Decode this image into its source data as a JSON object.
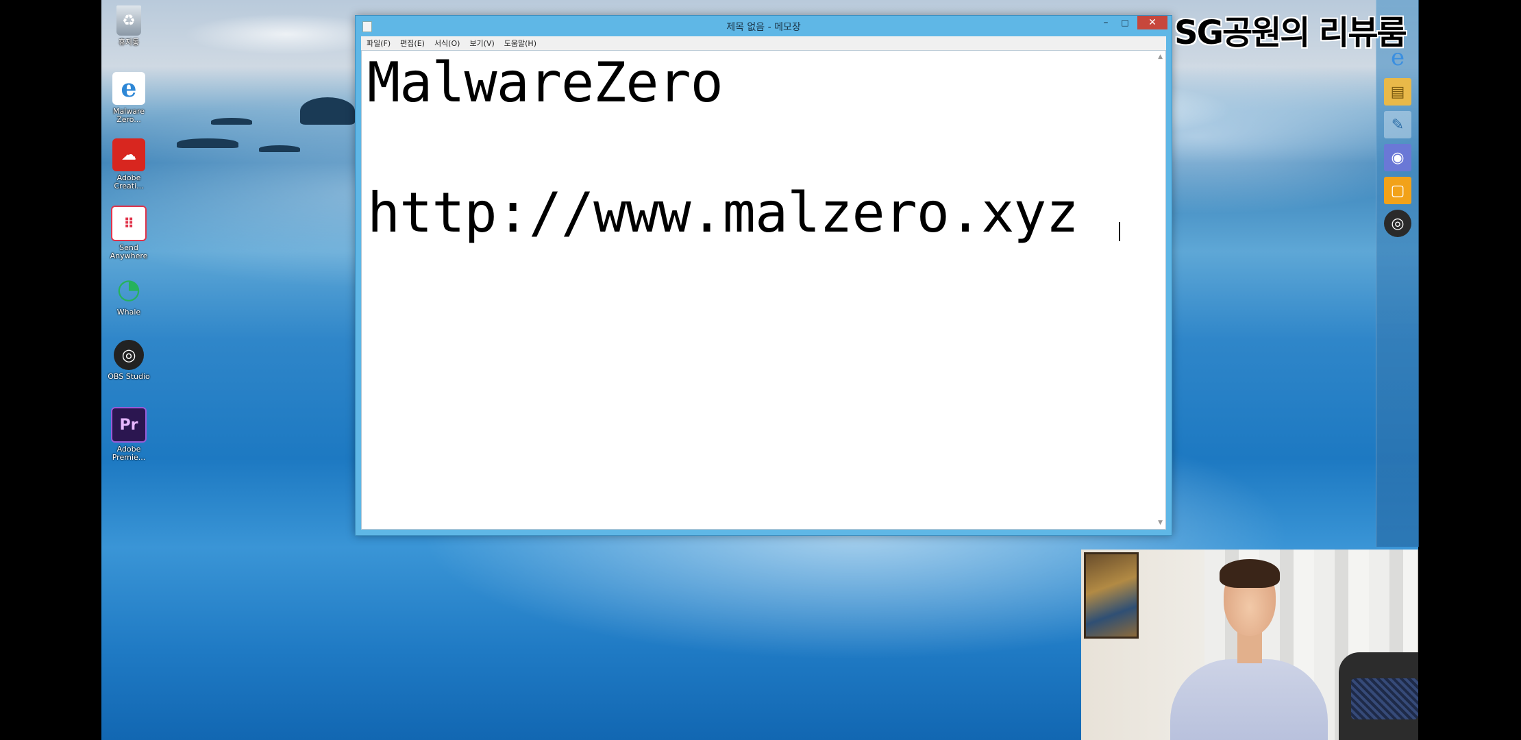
{
  "desktop": {
    "icons": [
      {
        "label": "휴지통",
        "icon": "recycle-bin-icon",
        "color": "#7a8a99"
      },
      {
        "label": "Malware Zero...",
        "icon": "internet-explorer-icon",
        "color": "#2e87d6"
      },
      {
        "label": "Adobe Creati...",
        "icon": "adobe-creative-cloud-icon",
        "color": "#d8261f"
      },
      {
        "label": "Send Anywhere",
        "icon": "send-anywhere-icon",
        "color": "#e0334a"
      },
      {
        "label": "Whale",
        "icon": "whale-browser-icon",
        "color": "#26b25c"
      },
      {
        "label": "OBS Studio",
        "icon": "obs-studio-icon",
        "color": "#2a2a2a"
      },
      {
        "label": "Adobe Premie...",
        "icon": "adobe-premiere-icon",
        "color": "#2b1650",
        "glyph": "Pr"
      }
    ]
  },
  "notepad": {
    "title": "제목 없음 - 메모장",
    "menu": [
      "파일(F)",
      "편집(E)",
      "서식(O)",
      "보기(V)",
      "도움말(H)"
    ],
    "lines": [
      "MalwareZero",
      "http://www.malzero.xyz"
    ],
    "controls": {
      "minimize": "–",
      "maximize": "□",
      "close": "✕"
    }
  },
  "taskbar": {
    "items": [
      {
        "icon": "internet-explorer-icon",
        "glyph": "e",
        "color": "#1e6fcf"
      },
      {
        "icon": "file-explorer-icon",
        "glyph": "▤",
        "color": "#e9b949"
      },
      {
        "icon": "notepad-icon",
        "glyph": "✎",
        "color": "#9fc6e8",
        "active": true
      },
      {
        "icon": "discord-icon",
        "glyph": "◉",
        "color": "#6a78d6"
      },
      {
        "icon": "sticky-app-icon",
        "glyph": "▢",
        "color": "#f2a219"
      },
      {
        "icon": "obs-studio-icon",
        "glyph": "◎",
        "color": "#2a2a2a"
      }
    ]
  },
  "watermark": "SG공원의 리뷰룸"
}
